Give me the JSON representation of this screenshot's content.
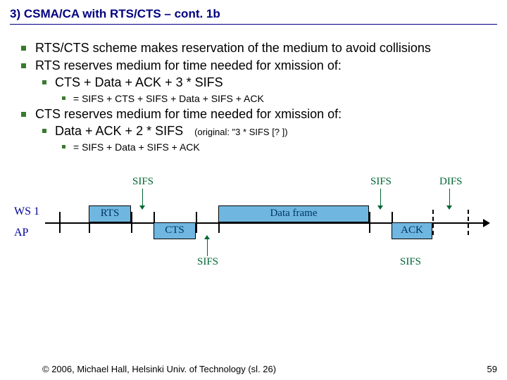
{
  "title": "3) CSMA/CA with RTS/CTS – cont. 1b",
  "bullets": {
    "a": "RTS/CTS scheme makes reservation of the medium to avoid collisions",
    "b": "RTS reserves medium for time needed for xmission of:",
    "b1": "CTS + Data + ACK + 3 * SIFS",
    "b1a": "= SIFS + CTS + SIFS + Data + SIFS + ACK",
    "c": "CTS reserves medium for time needed for xmission of:",
    "c1": "Data + ACK + 2 * SIFS",
    "c1note": "(original: \"3 * SIFS [? ])",
    "c1a": "= SIFS + Data + SIFS + ACK"
  },
  "diagram": {
    "ws": "WS 1",
    "ap": "AP",
    "rts": "RTS",
    "cts": "CTS",
    "data": "Data frame",
    "ack": "ACK",
    "sifs": "SIFS",
    "difs": "DIFS"
  },
  "copyright": "© 2006, Michael Hall, Helsinki Univ. of Technology (sl. 26)",
  "page": "59"
}
